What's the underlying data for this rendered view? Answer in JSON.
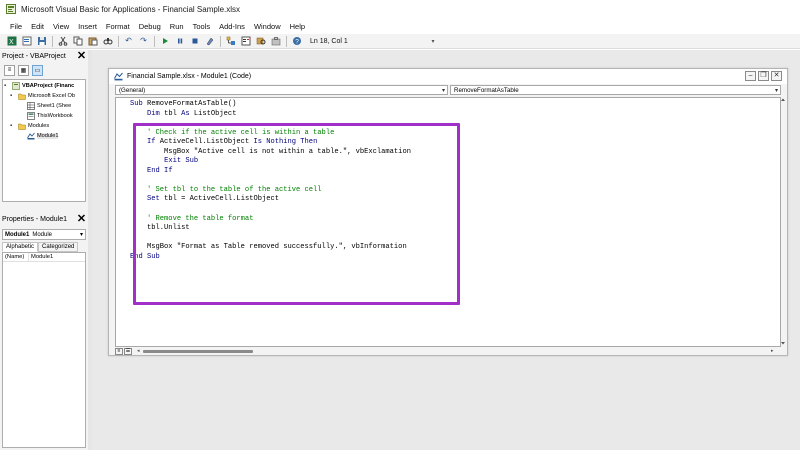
{
  "app": {
    "title": "Microsoft Visual Basic for Applications - Financial Sample.xlsx"
  },
  "menu": {
    "items": [
      "File",
      "Edit",
      "View",
      "Insert",
      "Format",
      "Debug",
      "Run",
      "Tools",
      "Add-Ins",
      "Window",
      "Help"
    ]
  },
  "toolbar": {
    "position": "Ln 18, Col 1"
  },
  "project_pane": {
    "title": "Project - VBAProject",
    "tree": [
      "VBAProject (Financ",
      "Microsoft Excel Ob",
      "Sheet1 (Shee",
      "ThisWorkbook",
      "Modules",
      "Module1"
    ]
  },
  "properties_pane": {
    "title": "Properties - Module1",
    "object_name": "Module1",
    "object_type": "Module",
    "tabs": [
      "Alphabetic",
      "Categorized"
    ],
    "rows": [
      {
        "key": "(Name)",
        "value": "Module1"
      }
    ]
  },
  "code_window": {
    "title": "Financial Sample.xlsx - Module1 (Code)",
    "object_combo": "(General)",
    "procedure_combo": "RemoveFormatAsTable",
    "lines": [
      [
        {
          "t": "kw",
          "v": "Sub"
        },
        {
          "t": "tx",
          "v": " RemoveFormatAsTable()"
        }
      ],
      [
        {
          "t": "tx",
          "v": "    "
        },
        {
          "t": "kw",
          "v": "Dim"
        },
        {
          "t": "tx",
          "v": " tbl "
        },
        {
          "t": "kw",
          "v": "As"
        },
        {
          "t": "tx",
          "v": " ListObject"
        }
      ],
      [
        {
          "t": "tx",
          "v": ""
        }
      ],
      [
        {
          "t": "cm",
          "v": "    ' Check if the active cell is within a table"
        }
      ],
      [
        {
          "t": "tx",
          "v": "    "
        },
        {
          "t": "kw",
          "v": "If"
        },
        {
          "t": "tx",
          "v": " ActiveCell.ListObject "
        },
        {
          "t": "kw",
          "v": "Is Nothing Then"
        }
      ],
      [
        {
          "t": "tx",
          "v": "        MsgBox \"Active cell is not within a table.\", vbExclamation"
        }
      ],
      [
        {
          "t": "tx",
          "v": "        "
        },
        {
          "t": "kw",
          "v": "Exit Sub"
        }
      ],
      [
        {
          "t": "tx",
          "v": "    "
        },
        {
          "t": "kw",
          "v": "End If"
        }
      ],
      [
        {
          "t": "tx",
          "v": ""
        }
      ],
      [
        {
          "t": "cm",
          "v": "    ' Set tbl to the table of the active cell"
        }
      ],
      [
        {
          "t": "tx",
          "v": "    "
        },
        {
          "t": "kw",
          "v": "Set"
        },
        {
          "t": "tx",
          "v": " tbl = ActiveCell.ListObject"
        }
      ],
      [
        {
          "t": "tx",
          "v": ""
        }
      ],
      [
        {
          "t": "cm",
          "v": "    ' Remove the table format"
        }
      ],
      [
        {
          "t": "tx",
          "v": "    tbl.Unlist"
        }
      ],
      [
        {
          "t": "tx",
          "v": ""
        }
      ],
      [
        {
          "t": "tx",
          "v": "    MsgBox \"Format as Table removed successfully.\", vbInformation"
        }
      ],
      [
        {
          "t": "kw",
          "v": "End Sub"
        }
      ]
    ]
  },
  "colors": {
    "keyword": "#00007f",
    "comment": "#008000",
    "highlight_border": "#a030c8"
  }
}
